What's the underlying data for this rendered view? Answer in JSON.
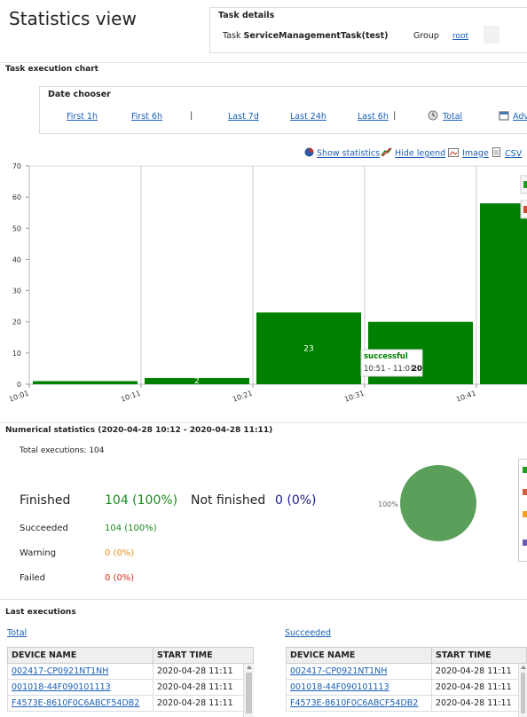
{
  "page": {
    "title": "Statistics view"
  },
  "task_details": {
    "header": "Task details",
    "task_label": "Task",
    "task_name": "ServiceManagementTask(test)",
    "group_label": "Group",
    "group_value": "root"
  },
  "chart_section": {
    "title": "Task execution chart",
    "date_chooser": {
      "title": "Date chooser",
      "items": [
        "First 1h",
        "First 6h",
        "Last 7d",
        "Last 24h",
        "Last 6h",
        "Total",
        "Adv"
      ],
      "separator": "|"
    },
    "tools": {
      "show_statistics": "Show statistics",
      "hide_legend": "Hide legend",
      "image": "Image",
      "csv": "CSV"
    },
    "tooltip": {
      "title": "successful",
      "range": "10:51 - 11:01:",
      "value": "20"
    }
  },
  "chart_data": {
    "type": "bar",
    "categories": [
      "10:01",
      "10:11",
      "10:21",
      "10:31",
      "10:41"
    ],
    "series": [
      {
        "values": [
          1,
          2,
          23,
          20,
          58
        ],
        "color": "#008000"
      }
    ],
    "data_labels": [
      "",
      "2",
      "23",
      "",
      ""
    ],
    "ylim": [
      0,
      70
    ],
    "yticks": [
      0,
      10,
      20,
      30,
      40,
      50,
      60,
      70
    ],
    "grid": true,
    "legend_colors": [
      "#1f9e1f",
      "#d04a2b"
    ]
  },
  "numerical": {
    "title": "Numerical statistics (2020-04-28 10:12 - 2020-04-28 11:11)",
    "total_label": "Total executions: 104",
    "finished_label": "Finished",
    "finished_value": "104 (100%)",
    "not_finished_label": "Not finished",
    "not_finished_value": "0 (0%)",
    "rows": [
      {
        "label": "Succeeded",
        "value": "104 (100%)",
        "color": "#1a8a1a"
      },
      {
        "label": "Warning",
        "value": "0 (0%)",
        "color": "#e8901a"
      },
      {
        "label": "Failed",
        "value": "0 (0%)",
        "color": "#d0301a"
      }
    ],
    "pie_label": "100%",
    "pie_color": "#5aa05a",
    "legend_colors": [
      "#1f9e1f",
      "#d06040",
      "#f0a020",
      "#6a5ab0"
    ]
  },
  "last_executions": {
    "title": "Last executions",
    "tables": [
      {
        "link": "Total",
        "columns": [
          "DEVICE NAME",
          "START TIME"
        ],
        "rows": [
          [
            "002417-CP0921NT1NH",
            "2020-04-28 11:11"
          ],
          [
            "001018-44F090101113",
            "2020-04-28 11:11"
          ],
          [
            "F4573E-8610F0C6ABCF54DB2",
            "2020-04-28 11:11"
          ]
        ]
      },
      {
        "link": "Succeeded",
        "columns": [
          "DEVICE NAME",
          "START TIME"
        ],
        "rows": [
          [
            "002417-CP0921NT1NH",
            "2020-04-28 11:11"
          ],
          [
            "001018-44F090101113",
            "2020-04-28 11:11"
          ],
          [
            "F4573E-8610F0C6ABCF54DB2",
            "2020-04-28 11:11"
          ]
        ]
      }
    ]
  }
}
